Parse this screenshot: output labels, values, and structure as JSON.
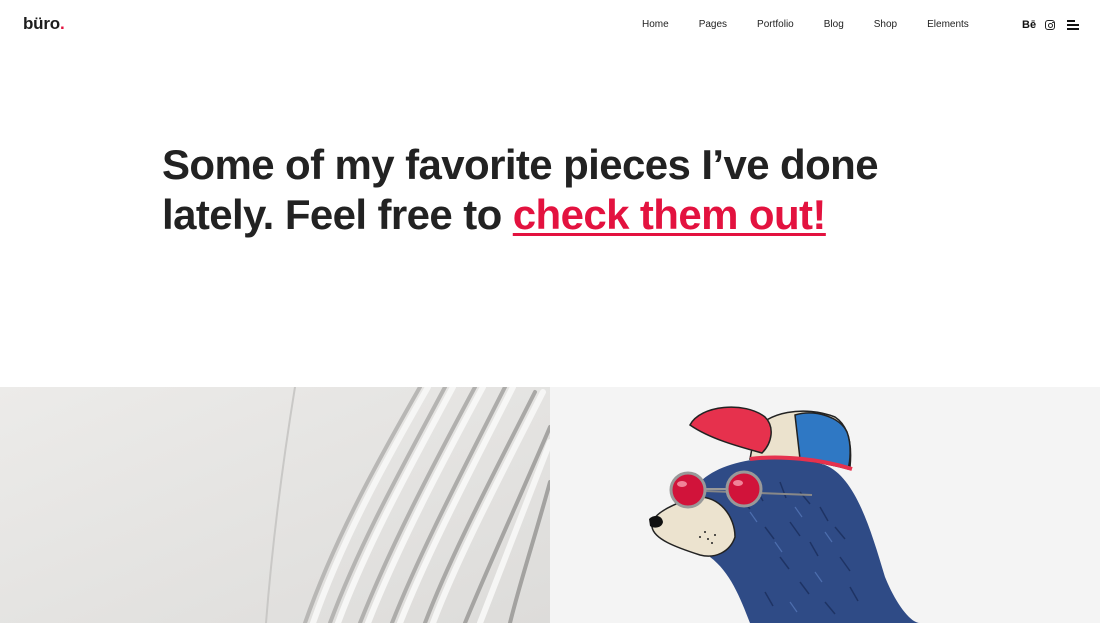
{
  "header": {
    "logo_text": "büro",
    "logo_dot": ".",
    "nav": [
      {
        "label": "Home"
      },
      {
        "label": "Pages"
      },
      {
        "label": "Portfolio"
      },
      {
        "label": "Blog"
      },
      {
        "label": "Shop"
      },
      {
        "label": "Elements"
      }
    ],
    "social": {
      "behance_label": "Bē",
      "instagram_icon": "instagram-icon",
      "menu_icon": "hamburger-menu-icon"
    }
  },
  "hero": {
    "text_before": "Some of my favorite pieces I’ve done lately. Feel free to ",
    "link_text": "check them out!"
  },
  "colors": {
    "accent": "#e3123f",
    "text": "#222222",
    "background": "#ffffff"
  }
}
